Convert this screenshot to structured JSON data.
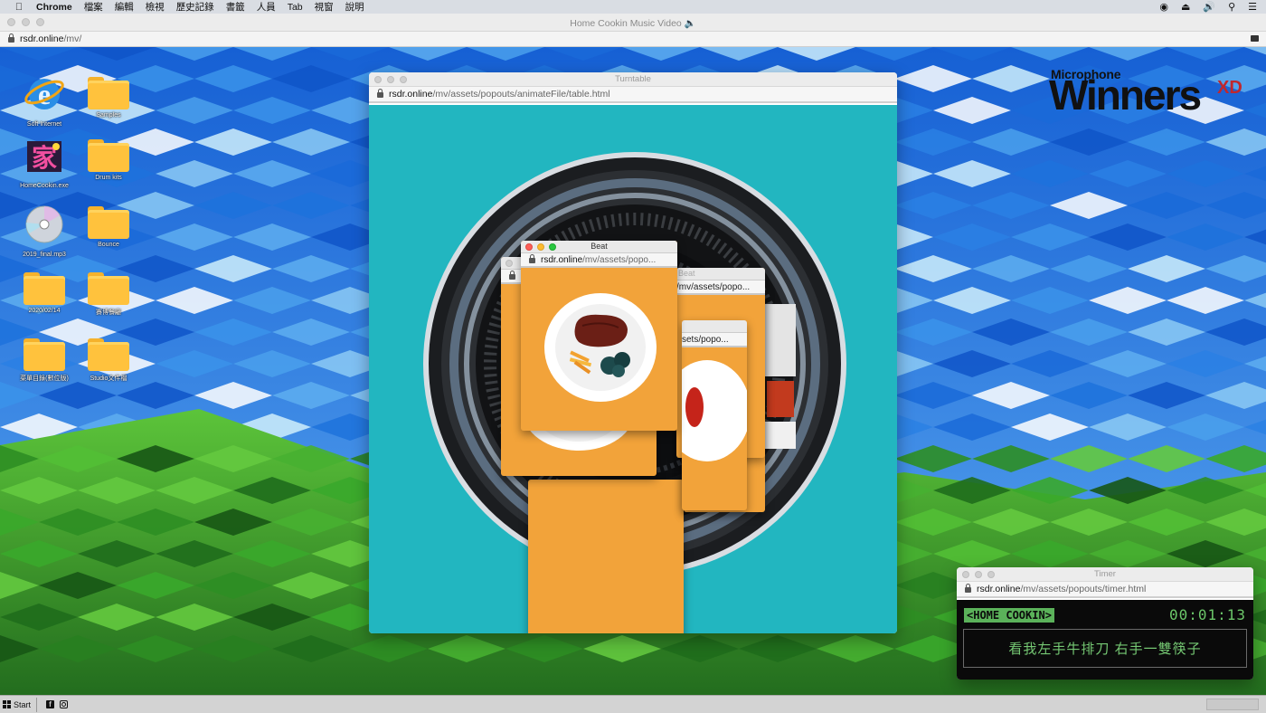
{
  "menubar": {
    "app": "Chrome",
    "items": [
      "檔案",
      "編輯",
      "檢視",
      "歷史記錄",
      "書籤",
      "人員",
      "Tab",
      "視窗",
      "說明"
    ]
  },
  "browser": {
    "title": "Home Cookin Music Video 🔈",
    "url_host": "rsdr.online",
    "url_path": "/mv/"
  },
  "desktop_icons": [
    {
      "label": "Soft Internet",
      "kind": "ie"
    },
    {
      "label": "Samples",
      "kind": "folder"
    },
    {
      "label": "HomeCookin.exe",
      "kind": "app"
    },
    {
      "label": "Drum kits",
      "kind": "folder"
    },
    {
      "label": "2019_final.mp3",
      "kind": "cd"
    },
    {
      "label": "Bounce",
      "kind": "folder"
    },
    {
      "label": "2020/02/14",
      "kind": "folder"
    },
    {
      "label": "賽博餐廳",
      "kind": "folder"
    },
    {
      "label": "菜單目錄(數位版)",
      "kind": "folder"
    },
    {
      "label": "Studio文件檔",
      "kind": "folder"
    }
  ],
  "logo": {
    "top": "Microphone",
    "main": "Winners",
    "suffix": "XD"
  },
  "turntable_window": {
    "title": "Turntable",
    "url_host": "rsdr.online",
    "url_path": "/mv/assets/popouts/animateFile/table.html"
  },
  "beat_windows": {
    "title": "Beat",
    "url_front_host": "rsdr.online",
    "url_front_path": "/mv/assets/popo...",
    "url_back1": "/mv/assets/popo...",
    "url_back2": "sets/popo..."
  },
  "timer_window": {
    "title": "Timer",
    "url_host": "rsdr.online",
    "url_path": "/mv/assets/popouts/timer.html",
    "tag": "<HOME COOKIN>",
    "clock": "00:01:13",
    "lyric": "看我左手牛排刀 右手一雙筷子"
  },
  "taskbar": {
    "start_label": "Start"
  },
  "colors": {
    "sky": "#1d6fd8",
    "grass": "#3fae2a",
    "teal": "#22b6c0",
    "plate_bg": "#f2a33a",
    "timer_green": "#6cc76a"
  }
}
